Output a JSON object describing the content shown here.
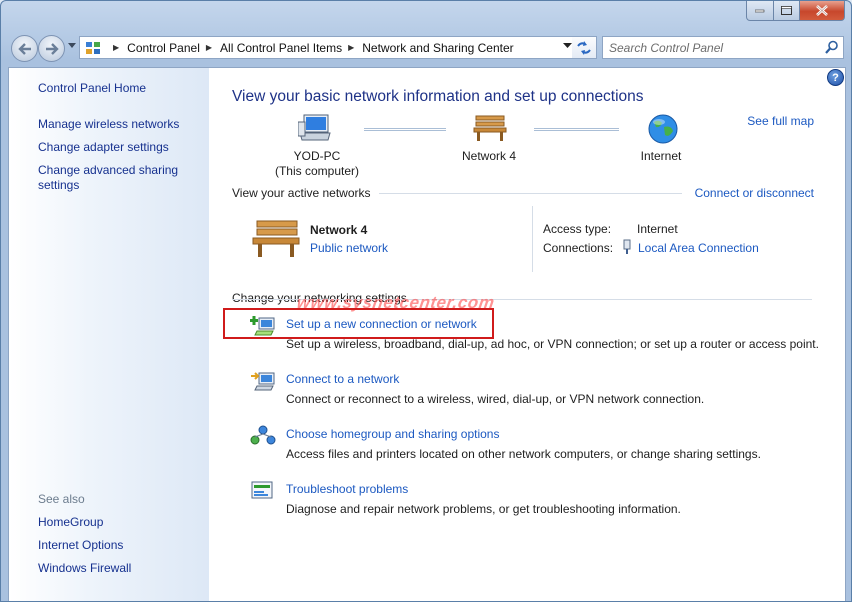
{
  "window": {
    "caption_buttons": [
      {
        "icon": "minimize-icon"
      },
      {
        "icon": "maximize-icon"
      },
      {
        "icon": "close-icon"
      }
    ]
  },
  "navigation": {
    "back_icon": "back-arrow-icon",
    "forward_icon": "forward-arrow-icon",
    "breadcrumb": [
      "Control Panel",
      "All Control Panel Items",
      "Network and Sharing Center"
    ],
    "refresh_icon": "refresh-icon",
    "search_placeholder": "Search Control Panel",
    "search_icon": "search-icon"
  },
  "sidebar": {
    "home": "Control Panel Home",
    "tasks": [
      "Manage wireless networks",
      "Change adapter settings",
      "Change advanced sharing settings"
    ],
    "see_also_heading": "See also",
    "see_also": [
      "HomeGroup",
      "Internet Options",
      "Windows Firewall"
    ]
  },
  "main": {
    "help_label": "?",
    "title": "View your basic network information and set up connections",
    "see_full_map": "See full map",
    "map": {
      "computer_name": "YOD-PC",
      "computer_sub": "(This computer)",
      "network_name": "Network  4",
      "internet": "Internet"
    },
    "active_heading": "View your active networks",
    "connect_disconnect": "Connect or disconnect",
    "active_network": {
      "name": "Network  4",
      "type_link": "Public network",
      "access_type_label": "Access type:",
      "access_type_value": "Internet",
      "connections_label": "Connections:",
      "connections_value": "Local Area Connection"
    },
    "settings_heading": "Change your networking settings",
    "watermark": "www.sysnetcenter.com",
    "tasks": [
      {
        "link": "Set up a new connection or network",
        "desc": "Set up a wireless, broadband, dial-up, ad hoc, or VPN connection; or set up a router or access point.",
        "icon": "new-connection-icon"
      },
      {
        "link": "Connect to a network",
        "desc": "Connect or reconnect to a wireless, wired, dial-up, or VPN network connection.",
        "icon": "connect-network-icon"
      },
      {
        "link": "Choose homegroup and sharing options",
        "desc": "Access files and printers located on other network computers, or change sharing settings.",
        "icon": "homegroup-icon"
      },
      {
        "link": "Troubleshoot problems",
        "desc": "Diagnose and repair network problems, or get troubleshooting information.",
        "icon": "troubleshoot-icon"
      }
    ]
  }
}
